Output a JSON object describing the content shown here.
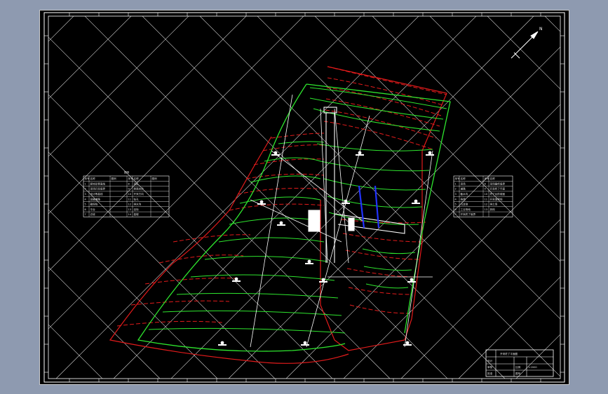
{
  "drawing": {
    "legend_title": "图例",
    "north_arrow_label": "N",
    "background": "#000000",
    "frame_color": "#ffffff",
    "colors": {
      "red_contour": "#e21b1b",
      "green_contour": "#2ee62e",
      "white_line": "#ffffff",
      "blue_accent": "#2233ff",
      "ui_backdrop": "#8e9ab0"
    }
  },
  "left_legend": {
    "headers": [
      "序号",
      "名称",
      "图例",
      "序号",
      "名称",
      "图例"
    ],
    "rows": [
      [
        "1",
        "原地形等高线",
        "",
        "8",
        "采区",
        ""
      ],
      [
        "2",
        "采场开采境界",
        "",
        "9",
        "剥离台阶",
        ""
      ],
      [
        "3",
        "设计等高线",
        "",
        "10",
        "开采方向",
        ""
      ],
      [
        "4",
        "运输道路",
        "",
        "11",
        "钻孔",
        ""
      ],
      [
        "5",
        "勘探线",
        "",
        "12",
        "排水沟",
        ""
      ],
      [
        "6",
        "平台",
        "",
        "13",
        "坐标",
        ""
      ],
      [
        "7",
        "边坡",
        "",
        "14",
        "高程",
        ""
      ]
    ]
  },
  "right_table": {
    "headers": [
      "序号",
      "名称",
      "序号",
      "名称"
    ],
    "rows": [
      [
        "1",
        "采场",
        "8",
        "采场最终境界"
      ],
      [
        "2",
        "道路",
        "9",
        "开采终了平面"
      ],
      [
        "3",
        "截水沟",
        "10",
        "终了台阶坡面"
      ],
      [
        "4",
        "挡墙",
        "11",
        "开采境界线"
      ],
      [
        "5",
        "沉淀池",
        "12",
        "排土场"
      ],
      [
        "6",
        "工业场地",
        "13",
        "其他"
      ],
      [
        "7",
        "开采终了境界",
        "",
        ""
      ]
    ]
  },
  "title_block": {
    "title": "开采终了平面图",
    "rows": [
      [
        "设计",
        "",
        "",
        ""
      ],
      [
        "审核",
        "",
        "比例",
        "1:2000"
      ],
      [
        "批准",
        "",
        "图号",
        ""
      ]
    ]
  }
}
